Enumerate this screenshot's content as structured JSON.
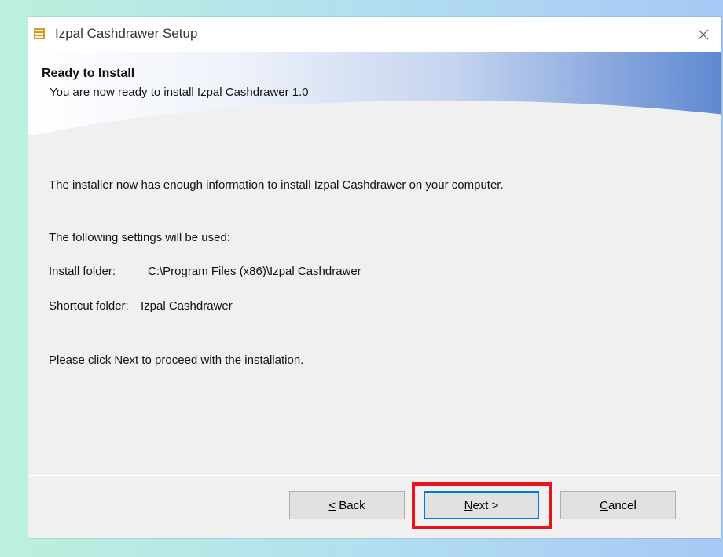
{
  "window": {
    "title": "Izpal Cashdrawer Setup",
    "icon": "installer-app-icon",
    "close_icon": "close-icon"
  },
  "banner": {
    "title": "Ready to Install",
    "subtitle": "You are now ready to install Izpal Cashdrawer 1.0"
  },
  "body": {
    "intro": "The installer now has enough information to install Izpal Cashdrawer on your computer.",
    "settings_heading": "The following settings will be used:",
    "install_folder_label": "Install folder:",
    "install_folder_value": "C:\\Program Files (x86)\\Izpal Cashdrawer",
    "shortcut_folder_label": "Shortcut folder:",
    "shortcut_folder_value": "Izpal Cashdrawer",
    "instruction": "Please click Next to proceed with the installation."
  },
  "buttons": {
    "back": "< Back",
    "next": "Next >",
    "cancel": "Cancel"
  },
  "colors": {
    "highlight": "#e8141b",
    "banner_accent": "#5f88d2",
    "default_button_border": "#0078d7"
  }
}
